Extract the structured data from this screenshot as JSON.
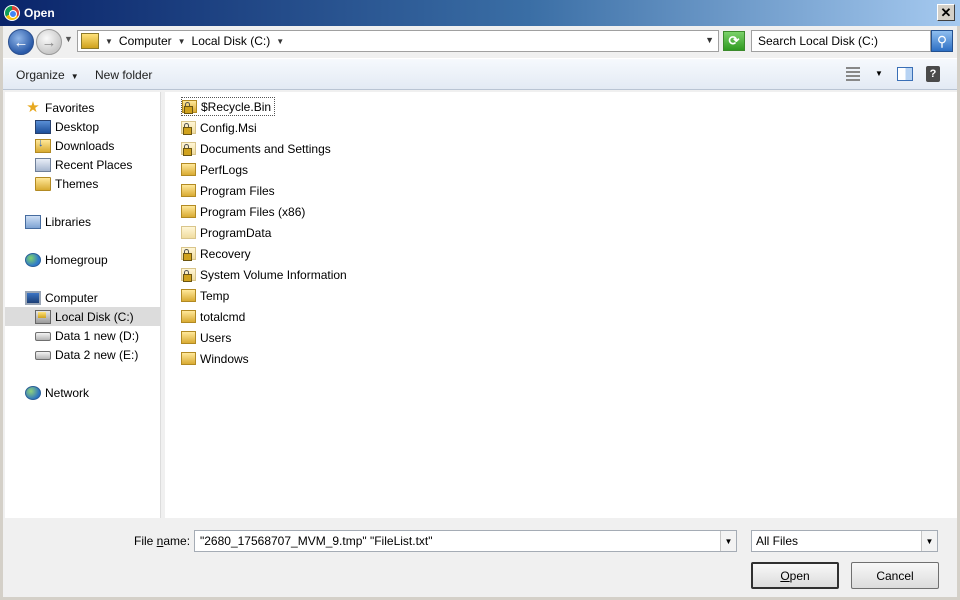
{
  "window": {
    "title": "Open"
  },
  "address": {
    "crumbs": [
      "Computer",
      "Local Disk (C:)"
    ]
  },
  "search": {
    "placeholder": "Search Local Disk (C:)"
  },
  "toolbar": {
    "organize_label": "Organize",
    "new_folder_label": "New folder"
  },
  "nav": {
    "favorites": "Favorites",
    "favorites_items": [
      "Desktop",
      "Downloads",
      "Recent Places",
      "Themes"
    ],
    "libraries": "Libraries",
    "homegroup": "Homegroup",
    "computer": "Computer",
    "computer_items": [
      "Local Disk (C:)",
      "Data 1 new (D:)",
      "Data 2 new (E:)"
    ],
    "network": "Network"
  },
  "files": [
    {
      "name": "$Recycle.Bin",
      "icon": "locked-folder"
    },
    {
      "name": "Config.Msi",
      "icon": "locked-folder"
    },
    {
      "name": "Documents and Settings",
      "icon": "locked-folder"
    },
    {
      "name": "PerfLogs",
      "icon": "folder"
    },
    {
      "name": "Program Files",
      "icon": "folder"
    },
    {
      "name": "Program Files (x86)",
      "icon": "folder"
    },
    {
      "name": "ProgramData",
      "icon": "hidden-folder"
    },
    {
      "name": "Recovery",
      "icon": "locked-folder"
    },
    {
      "name": "System Volume Information",
      "icon": "locked-folder"
    },
    {
      "name": "Temp",
      "icon": "folder"
    },
    {
      "name": "totalcmd",
      "icon": "folder"
    },
    {
      "name": "Users",
      "icon": "folder"
    },
    {
      "name": "Windows",
      "icon": "folder"
    }
  ],
  "bottom": {
    "file_name_label_pre": "File ",
    "file_name_label_underlined": "n",
    "file_name_label_post": "ame:",
    "file_name_value": "\"2680_17568707_MVM_9.tmp\" \"FileList.txt\"",
    "filter_value": "All Files",
    "open_label_underlined": "O",
    "open_label_rest": "pen",
    "cancel_label": "Cancel"
  }
}
